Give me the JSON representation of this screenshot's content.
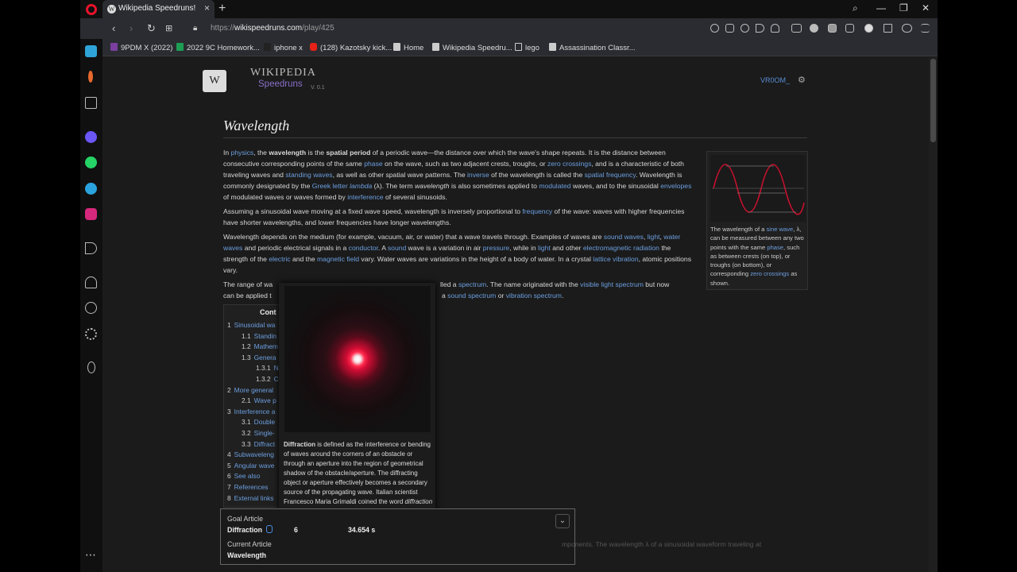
{
  "browser": {
    "tab_title": "Wikipedia Speedruns!",
    "url_prefix": "https://",
    "url_host": "wikispeedruns.com",
    "url_path": "/play/425",
    "bookmarks": [
      "9PDM X (2022)",
      "2022 9C Homework...",
      "iphone x",
      "(128) Kazotsky kick...",
      "Home",
      "Wikipedia Speedru...",
      "lego",
      "Assassination Classr..."
    ]
  },
  "header": {
    "logo_wiki": "WIKIPEDIA",
    "logo_speedruns": "Speedruns",
    "version": "V. 0.1",
    "username": "VR0OM_"
  },
  "article": {
    "title": "Wavelength",
    "p1": [
      {
        "t": "In "
      },
      {
        "t": "physics",
        "l": true
      },
      {
        "t": ", the "
      },
      {
        "t": "wavelength",
        "b": true
      },
      {
        "t": " is the "
      },
      {
        "t": "spatial period",
        "b": true
      },
      {
        "t": " of a periodic wave—the distance over which the wave's shape repeats. It is the distance between consecutive corresponding points of the same "
      },
      {
        "t": "phase",
        "l": true
      },
      {
        "t": " on the wave, such as two adjacent crests, troughs, or "
      },
      {
        "t": "zero crossings",
        "l": true
      },
      {
        "t": ", and is a characteristic of both traveling waves and "
      },
      {
        "t": "standing waves",
        "l": true
      },
      {
        "t": ", as well as other spatial wave patterns. The "
      },
      {
        "t": "inverse",
        "l": true
      },
      {
        "t": " of the wavelength is called the "
      },
      {
        "t": "spatial frequency",
        "l": true
      },
      {
        "t": ". Wavelength is commonly designated by the "
      },
      {
        "t": "Greek letter ",
        "l": true
      },
      {
        "t": "lambda",
        "l": true,
        "i": true
      },
      {
        "t": " (λ). The term "
      },
      {
        "t": "wavelength",
        "i": true
      },
      {
        "t": " is also sometimes applied to "
      },
      {
        "t": "modulated",
        "l": true
      },
      {
        "t": " waves, and to the sinusoidal "
      },
      {
        "t": "envelopes",
        "l": true
      },
      {
        "t": " of modulated waves or waves formed by "
      },
      {
        "t": "interference",
        "l": true
      },
      {
        "t": " of several sinusoids."
      }
    ],
    "p2": [
      {
        "t": "Assuming a sinusoidal wave moving at a fixed wave speed, wavelength is inversely proportional to "
      },
      {
        "t": "frequency",
        "l": true
      },
      {
        "t": " of the wave: waves with higher frequencies have shorter wavelengths, and lower frequencies have longer wavelengths."
      }
    ],
    "p3": [
      {
        "t": "Wavelength depends on the medium (for example, vacuum, air, or water) that a wave travels through. Examples of waves are "
      },
      {
        "t": "sound waves",
        "l": true
      },
      {
        "t": ", "
      },
      {
        "t": "light",
        "l": true
      },
      {
        "t": ", "
      },
      {
        "t": "water waves",
        "l": true
      },
      {
        "t": " and periodic electrical signals in a "
      },
      {
        "t": "conductor",
        "l": true
      },
      {
        "t": ". A "
      },
      {
        "t": "sound",
        "l": true
      },
      {
        "t": " wave is a variation in air "
      },
      {
        "t": "pressure",
        "l": true
      },
      {
        "t": ", while in "
      },
      {
        "t": "light",
        "l": true
      },
      {
        "t": " and other "
      },
      {
        "t": "electromagnetic radiation",
        "l": true
      },
      {
        "t": " the strength of the "
      },
      {
        "t": "electric",
        "l": true
      },
      {
        "t": " and the "
      },
      {
        "t": "magnetic field",
        "l": true
      },
      {
        "t": " vary. Water waves are variations in the height of a body of water. In a crystal "
      },
      {
        "t": "lattice vibration",
        "l": true
      },
      {
        "t": ", atomic positions vary."
      }
    ],
    "p4a": "The range of wa",
    "p4b": [
      {
        "t": "lled a "
      },
      {
        "t": "spectrum",
        "l": true
      },
      {
        "t": ". The name originated with the "
      },
      {
        "t": "visible light spectrum",
        "l": true
      },
      {
        "t": " but now"
      }
    ],
    "p4c": "can be applied t",
    "p4d": [
      {
        "t": "a "
      },
      {
        "t": "sound spectrum",
        "l": true
      },
      {
        "t": " or "
      },
      {
        "t": "vibration spectrum",
        "l": true
      },
      {
        "t": "."
      }
    ],
    "infobox_caption": [
      {
        "t": "The wavelength of a "
      },
      {
        "t": "sine wave",
        "l": true
      },
      {
        "t": ", λ, can be measured between any two points with the same "
      },
      {
        "t": "phase",
        "l": true
      },
      {
        "t": ", such as between crests (on top), or troughs (on bottom), or corresponding "
      },
      {
        "t": "zero crossings",
        "l": true
      },
      {
        "t": " as shown."
      }
    ],
    "faded_text": "mponents. The wavelength λ of a sinusoidal waveform traveling at"
  },
  "toc": {
    "title": "Cont",
    "items": [
      {
        "num": "1",
        "label": "Sinusoidal wa",
        "level": 0
      },
      {
        "num": "1.1",
        "label": "Standin",
        "level": 1
      },
      {
        "num": "1.2",
        "label": "Mathem",
        "level": 1
      },
      {
        "num": "1.3",
        "label": "Genera",
        "level": 1
      },
      {
        "num": "1.3.1",
        "label": "N",
        "level": 2
      },
      {
        "num": "1.3.2",
        "label": "C",
        "level": 2
      },
      {
        "num": "2",
        "label": "More general",
        "level": 0
      },
      {
        "num": "2.1",
        "label": "Wave p",
        "level": 1
      },
      {
        "num": "3",
        "label": "Interference a",
        "level": 0
      },
      {
        "num": "3.1",
        "label": "Double",
        "level": 1
      },
      {
        "num": "3.2",
        "label": "Single-",
        "level": 1
      },
      {
        "num": "3.3",
        "label": "Diffract",
        "level": 1
      },
      {
        "num": "4",
        "label": "Subwaveleng",
        "level": 0
      },
      {
        "num": "5",
        "label": "Angular wave",
        "level": 0
      },
      {
        "num": "6",
        "label": "See also",
        "level": 0
      },
      {
        "num": "7",
        "label": "References",
        "level": 0
      },
      {
        "num": "8",
        "label": "External links",
        "level": 0
      }
    ]
  },
  "popup": {
    "text": [
      {
        "t": "Diffraction",
        "b": true
      },
      {
        "t": " is defined as the interference or bending of waves around the corners of an obstacle or through an aperture into the region of geometrical shadow of the obstacle/aperture. The diffracting object or aperture effectively becomes a secondary source of the propagating wave. Italian scientist Francesco Maria Grimaldi coined the word "
      },
      {
        "t": "diffraction",
        "i": true
      },
      {
        "t": " and was the first to record accurate observ"
      }
    ]
  },
  "goal_panel": {
    "goal_label": "Goal Article",
    "goal_value": "Diffraction",
    "clicks": "6",
    "time": "34.654 s",
    "current_label": "Current Article",
    "current_value": "Wavelength",
    "toggle_glyph": "⌄"
  }
}
